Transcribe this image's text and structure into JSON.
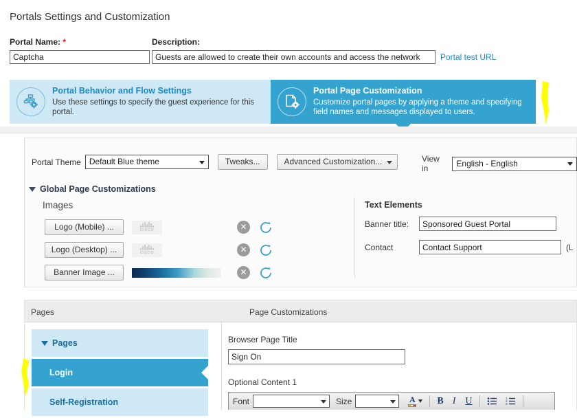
{
  "header": {
    "page_title": "Portals Settings and Customization",
    "portal_name_label": "Portal Name:",
    "required_marker": "*",
    "portal_name_value": "Captcha",
    "description_label": "Description:",
    "description_value": "Guests are allowed to create their own accounts and access the network",
    "portal_test_url_link": "Portal test URL"
  },
  "steps": [
    {
      "title": "Portal Behavior and Flow Settings",
      "description": "Use these settings to specify the guest experience for this portal.",
      "icon": "flow-gear-icon",
      "selected": false
    },
    {
      "title": "Portal Page Customization",
      "description": "Customize portal pages by applying a theme and specifying field names and messages displayed to users.",
      "icon": "page-gear-icon",
      "selected": true
    }
  ],
  "toolbar": {
    "portal_theme_label": "Portal Theme",
    "portal_theme_value": "Default Blue theme",
    "tweaks_button": "Tweaks...",
    "advanced_customization_button": "Advanced Customization...",
    "view_in_label": "View in",
    "language_value": "English - English"
  },
  "global_customizations": {
    "section_title": "Global Page Customizations",
    "images_heading": "Images",
    "image_rows": [
      {
        "button_label": "Logo (Mobile) ...",
        "thumbnail": "cisco-logo-thumbnail"
      },
      {
        "button_label": "Logo (Desktop) ...",
        "thumbnail": "cisco-logo-thumbnail"
      },
      {
        "button_label": "Banner Image ...",
        "thumbnail": "blue-gradient-banner-thumbnail"
      }
    ],
    "clear_icon": "clear-x-icon",
    "reset_icon": "reset-circular-arrow-icon",
    "text_elements_heading": "Text Elements",
    "banner_title_label": "Banner title:",
    "banner_title_value": "Sponsored Guest Portal",
    "contact_label": "Contact",
    "contact_value": "Contact Support",
    "contact_suffix": "(L"
  },
  "pages_panel": {
    "left_header": "Pages",
    "right_header": "Page Customizations",
    "items": [
      {
        "label": "Pages",
        "type": "group-header",
        "expanded": true,
        "selected": false
      },
      {
        "label": "Login",
        "type": "page",
        "selected": true
      },
      {
        "label": "Self-Registration",
        "type": "page",
        "selected": false
      }
    ]
  },
  "page_customizations": {
    "browser_page_title_label": "Browser Page Title",
    "browser_page_title_value": "Sign On",
    "optional_content_label": "Optional Content 1",
    "editor": {
      "font_label": "Font",
      "font_value": "",
      "size_label": "Size",
      "size_value": "",
      "font_color_icon": "font-color-icon",
      "bold_icon": "bold-icon",
      "italic_icon": "italic-icon",
      "underline_icon": "underline-icon",
      "bulleted_list_icon": "bulleted-list-icon",
      "numbered_list_icon": "numbered-list-icon",
      "bold_glyph": "B",
      "italic_glyph": "I",
      "underline_glyph": "U",
      "font_color_glyph": "A"
    }
  },
  "annotations": {
    "highlight_right": "yellow-highlight-mark",
    "highlight_left": "yellow-highlight-mark"
  },
  "colors": {
    "accent_blue": "#34a3d0",
    "light_blue": "#cfe8f5",
    "link_blue": "#1a8cc8",
    "highlight_yellow": "#ffff00",
    "required_red": "#d01919"
  }
}
